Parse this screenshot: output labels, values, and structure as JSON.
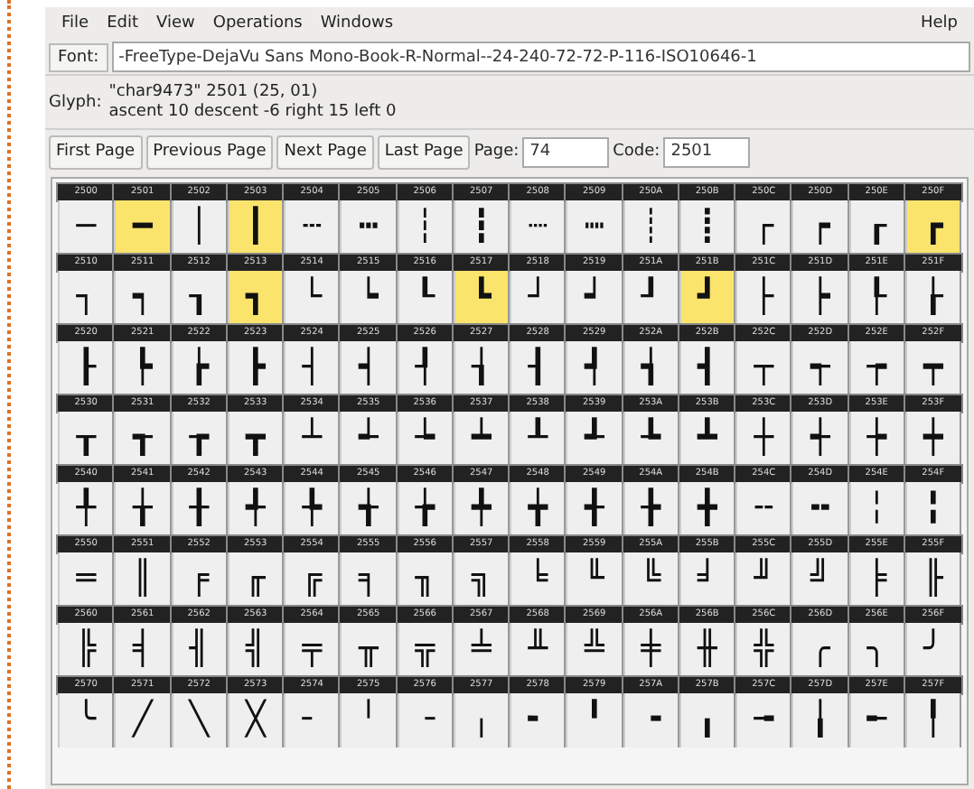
{
  "menu": [
    "File",
    "Edit",
    "View",
    "Operations",
    "Windows"
  ],
  "help_menu": "Help",
  "font": {
    "label": "Font:",
    "value": "-FreeType-DejaVu Sans Mono-Book-R-Normal--24-240-72-72-P-116-ISO10646-1"
  },
  "glyph": {
    "label": "Glyph:",
    "line_1": "\"char9473\" 2501 (25, 01)",
    "line_2": "ascent 10 descent -6 right 15 left 0"
  },
  "buttons": [
    "First Page",
    "Previous Page",
    "Next Page",
    "Last Page"
  ],
  "page": {
    "label": "Page:",
    "value": "74"
  },
  "code": {
    "label": "Code:",
    "value": "2501"
  },
  "grid": [
    {
      "cells": [
        {
          "code": "2500",
          "glyph": "─",
          "highlighted": false
        },
        {
          "code": "2501",
          "glyph": "━",
          "highlighted": true
        },
        {
          "code": "2502",
          "glyph": "│",
          "highlighted": false
        },
        {
          "code": "2503",
          "glyph": "┃",
          "highlighted": true
        },
        {
          "code": "2504",
          "glyph": "┄",
          "highlighted": false
        },
        {
          "code": "2505",
          "glyph": "┅",
          "highlighted": false
        },
        {
          "code": "2506",
          "glyph": "┆",
          "highlighted": false
        },
        {
          "code": "2507",
          "glyph": "┇",
          "highlighted": false
        },
        {
          "code": "2508",
          "glyph": "┈",
          "highlighted": false
        },
        {
          "code": "2509",
          "glyph": "┉",
          "highlighted": false
        },
        {
          "code": "250A",
          "glyph": "┊",
          "highlighted": false
        },
        {
          "code": "250B",
          "glyph": "┋",
          "highlighted": false
        },
        {
          "code": "250C",
          "glyph": "┌",
          "highlighted": false
        },
        {
          "code": "250D",
          "glyph": "┍",
          "highlighted": false
        },
        {
          "code": "250E",
          "glyph": "┎",
          "highlighted": false
        },
        {
          "code": "250F",
          "glyph": "┏",
          "highlighted": true
        }
      ]
    },
    {
      "cells": [
        {
          "code": "2510",
          "glyph": "┐",
          "highlighted": false
        },
        {
          "code": "2511",
          "glyph": "┑",
          "highlighted": false
        },
        {
          "code": "2512",
          "glyph": "┒",
          "highlighted": false
        },
        {
          "code": "2513",
          "glyph": "┓",
          "highlighted": true
        },
        {
          "code": "2514",
          "glyph": "└",
          "highlighted": false
        },
        {
          "code": "2515",
          "glyph": "┕",
          "highlighted": false
        },
        {
          "code": "2516",
          "glyph": "┖",
          "highlighted": false
        },
        {
          "code": "2517",
          "glyph": "┗",
          "highlighted": true
        },
        {
          "code": "2518",
          "glyph": "┘",
          "highlighted": false
        },
        {
          "code": "2519",
          "glyph": "┙",
          "highlighted": false
        },
        {
          "code": "251A",
          "glyph": "┚",
          "highlighted": false
        },
        {
          "code": "251B",
          "glyph": "┛",
          "highlighted": true
        },
        {
          "code": "251C",
          "glyph": "├",
          "highlighted": false
        },
        {
          "code": "251D",
          "glyph": "┝",
          "highlighted": false
        },
        {
          "code": "251E",
          "glyph": "┞",
          "highlighted": false
        },
        {
          "code": "251F",
          "glyph": "┟",
          "highlighted": false
        }
      ]
    },
    {
      "cells": [
        {
          "code": "2520",
          "glyph": "┠",
          "highlighted": false
        },
        {
          "code": "2521",
          "glyph": "┡",
          "highlighted": false
        },
        {
          "code": "2522",
          "glyph": "┢",
          "highlighted": false
        },
        {
          "code": "2523",
          "glyph": "┣",
          "highlighted": false
        },
        {
          "code": "2524",
          "glyph": "┤",
          "highlighted": false
        },
        {
          "code": "2525",
          "glyph": "┥",
          "highlighted": false
        },
        {
          "code": "2526",
          "glyph": "┦",
          "highlighted": false
        },
        {
          "code": "2527",
          "glyph": "┧",
          "highlighted": false
        },
        {
          "code": "2528",
          "glyph": "┨",
          "highlighted": false
        },
        {
          "code": "2529",
          "glyph": "┩",
          "highlighted": false
        },
        {
          "code": "252A",
          "glyph": "┪",
          "highlighted": false
        },
        {
          "code": "252B",
          "glyph": "┫",
          "highlighted": false
        },
        {
          "code": "252C",
          "glyph": "┬",
          "highlighted": false
        },
        {
          "code": "252D",
          "glyph": "┭",
          "highlighted": false
        },
        {
          "code": "252E",
          "glyph": "┮",
          "highlighted": false
        },
        {
          "code": "252F",
          "glyph": "┯",
          "highlighted": false
        }
      ]
    },
    {
      "cells": [
        {
          "code": "2530",
          "glyph": "┰",
          "highlighted": false
        },
        {
          "code": "2531",
          "glyph": "┱",
          "highlighted": false
        },
        {
          "code": "2532",
          "glyph": "┲",
          "highlighted": false
        },
        {
          "code": "2533",
          "glyph": "┳",
          "highlighted": false
        },
        {
          "code": "2534",
          "glyph": "┴",
          "highlighted": false
        },
        {
          "code": "2535",
          "glyph": "┵",
          "highlighted": false
        },
        {
          "code": "2536",
          "glyph": "┶",
          "highlighted": false
        },
        {
          "code": "2537",
          "glyph": "┷",
          "highlighted": false
        },
        {
          "code": "2538",
          "glyph": "┸",
          "highlighted": false
        },
        {
          "code": "2539",
          "glyph": "┹",
          "highlighted": false
        },
        {
          "code": "253A",
          "glyph": "┺",
          "highlighted": false
        },
        {
          "code": "253B",
          "glyph": "┻",
          "highlighted": false
        },
        {
          "code": "253C",
          "glyph": "┼",
          "highlighted": false
        },
        {
          "code": "253D",
          "glyph": "┽",
          "highlighted": false
        },
        {
          "code": "253E",
          "glyph": "┾",
          "highlighted": false
        },
        {
          "code": "253F",
          "glyph": "┿",
          "highlighted": false
        }
      ]
    },
    {
      "cells": [
        {
          "code": "2540",
          "glyph": "╀",
          "highlighted": false
        },
        {
          "code": "2541",
          "glyph": "╁",
          "highlighted": false
        },
        {
          "code": "2542",
          "glyph": "╂",
          "highlighted": false
        },
        {
          "code": "2543",
          "glyph": "╃",
          "highlighted": false
        },
        {
          "code": "2544",
          "glyph": "╄",
          "highlighted": false
        },
        {
          "code": "2545",
          "glyph": "╅",
          "highlighted": false
        },
        {
          "code": "2546",
          "glyph": "╆",
          "highlighted": false
        },
        {
          "code": "2547",
          "glyph": "╇",
          "highlighted": false
        },
        {
          "code": "2548",
          "glyph": "╈",
          "highlighted": false
        },
        {
          "code": "2549",
          "glyph": "╉",
          "highlighted": false
        },
        {
          "code": "254A",
          "glyph": "╊",
          "highlighted": false
        },
        {
          "code": "254B",
          "glyph": "╋",
          "highlighted": false
        },
        {
          "code": "254C",
          "glyph": "╌",
          "highlighted": false
        },
        {
          "code": "254D",
          "glyph": "╍",
          "highlighted": false
        },
        {
          "code": "254E",
          "glyph": "╎",
          "highlighted": false
        },
        {
          "code": "254F",
          "glyph": "╏",
          "highlighted": false
        }
      ]
    },
    {
      "cells": [
        {
          "code": "2550",
          "glyph": "═",
          "highlighted": false
        },
        {
          "code": "2551",
          "glyph": "║",
          "highlighted": false
        },
        {
          "code": "2552",
          "glyph": "╒",
          "highlighted": false
        },
        {
          "code": "2553",
          "glyph": "╓",
          "highlighted": false
        },
        {
          "code": "2554",
          "glyph": "╔",
          "highlighted": false
        },
        {
          "code": "2555",
          "glyph": "╕",
          "highlighted": false
        },
        {
          "code": "2556",
          "glyph": "╖",
          "highlighted": false
        },
        {
          "code": "2557",
          "glyph": "╗",
          "highlighted": false
        },
        {
          "code": "2558",
          "glyph": "╘",
          "highlighted": false
        },
        {
          "code": "2559",
          "glyph": "╙",
          "highlighted": false
        },
        {
          "code": "255A",
          "glyph": "╚",
          "highlighted": false
        },
        {
          "code": "255B",
          "glyph": "╛",
          "highlighted": false
        },
        {
          "code": "255C",
          "glyph": "╜",
          "highlighted": false
        },
        {
          "code": "255D",
          "glyph": "╝",
          "highlighted": false
        },
        {
          "code": "255E",
          "glyph": "╞",
          "highlighted": false
        },
        {
          "code": "255F",
          "glyph": "╟",
          "highlighted": false
        }
      ]
    },
    {
      "cells": [
        {
          "code": "2560",
          "glyph": "╠",
          "highlighted": false
        },
        {
          "code": "2561",
          "glyph": "╡",
          "highlighted": false
        },
        {
          "code": "2562",
          "glyph": "╢",
          "highlighted": false
        },
        {
          "code": "2563",
          "glyph": "╣",
          "highlighted": false
        },
        {
          "code": "2564",
          "glyph": "╤",
          "highlighted": false
        },
        {
          "code": "2565",
          "glyph": "╥",
          "highlighted": false
        },
        {
          "code": "2566",
          "glyph": "╦",
          "highlighted": false
        },
        {
          "code": "2567",
          "glyph": "╧",
          "highlighted": false
        },
        {
          "code": "2568",
          "glyph": "╨",
          "highlighted": false
        },
        {
          "code": "2569",
          "glyph": "╩",
          "highlighted": false
        },
        {
          "code": "256A",
          "glyph": "╪",
          "highlighted": false
        },
        {
          "code": "256B",
          "glyph": "╫",
          "highlighted": false
        },
        {
          "code": "256C",
          "glyph": "╬",
          "highlighted": false
        },
        {
          "code": "256D",
          "glyph": "╭",
          "highlighted": false
        },
        {
          "code": "256E",
          "glyph": "╮",
          "highlighted": false
        },
        {
          "code": "256F",
          "glyph": "╯",
          "highlighted": false
        }
      ]
    },
    {
      "cells": [
        {
          "code": "2570",
          "glyph": "╰",
          "highlighted": false
        },
        {
          "code": "2571",
          "glyph": "╱",
          "highlighted": false
        },
        {
          "code": "2572",
          "glyph": "╲",
          "highlighted": false
        },
        {
          "code": "2573",
          "glyph": "╳",
          "highlighted": false
        },
        {
          "code": "2574",
          "glyph": "╴",
          "highlighted": false
        },
        {
          "code": "2575",
          "glyph": "╵",
          "highlighted": false
        },
        {
          "code": "2576",
          "glyph": "╶",
          "highlighted": false
        },
        {
          "code": "2577",
          "glyph": "╷",
          "highlighted": false
        },
        {
          "code": "2578",
          "glyph": "╸",
          "highlighted": false
        },
        {
          "code": "2579",
          "glyph": "╹",
          "highlighted": false
        },
        {
          "code": "257A",
          "glyph": "╺",
          "highlighted": false
        },
        {
          "code": "257B",
          "glyph": "╻",
          "highlighted": false
        },
        {
          "code": "257C",
          "glyph": "╼",
          "highlighted": false
        },
        {
          "code": "257D",
          "glyph": "╽",
          "highlighted": false
        },
        {
          "code": "257E",
          "glyph": "╾",
          "highlighted": false
        },
        {
          "code": "257F",
          "glyph": "╿",
          "highlighted": false
        }
      ]
    }
  ]
}
